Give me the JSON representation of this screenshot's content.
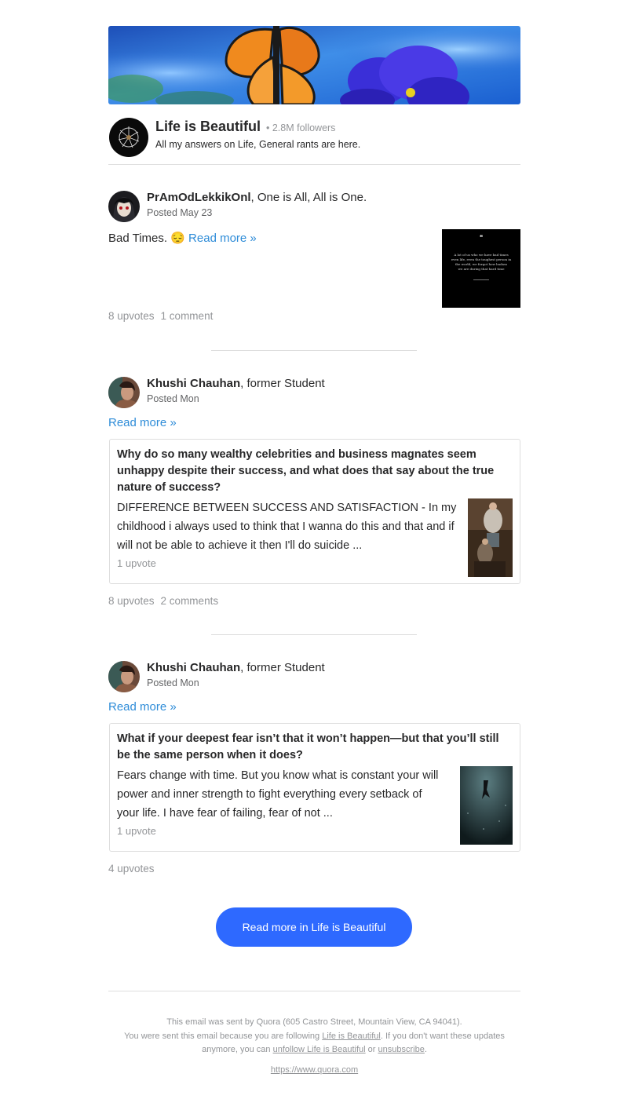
{
  "space": {
    "name": "Life is Beautiful",
    "followers": "• 2.8M followers",
    "description": "All my answers on Life, General rants are here."
  },
  "posts": [
    {
      "author_name": "PrAmOdLekkikOnl",
      "author_credential": ", One is All, All is One.",
      "posted": "Posted May 23",
      "text": "Bad Times. 😔",
      "read_more": "Read more »",
      "quote_lines": [
        "❝",
        "A lot of us who we have bad times",
        "even life, even the toughest person in",
        "the world, we forgot how badass",
        "we are during that hard time"
      ],
      "upvotes": "8 upvotes",
      "comments": "1 comment"
    },
    {
      "author_name": "Khushi Chauhan",
      "author_credential": ", former Student",
      "posted": "Posted Mon",
      "read_more": "Read more »",
      "card": {
        "question": "Why do so many wealthy celebrities and business magnates seem unhappy despite their success, and what does that say about the true nature of success?",
        "lines": [
          "DIFFERENCE BETWEEN SUCCESS AND SATISFACTION - In my",
          "childhood i always used to think that I wanna do this and that and if",
          "will not be able to achieve it then I'll do suicide ..."
        ],
        "upvote": "1 upvote"
      },
      "upvotes": "8 upvotes",
      "comments": "2 comments"
    },
    {
      "author_name": "Khushi Chauhan",
      "author_credential": ", former Student",
      "posted": "Posted Mon",
      "read_more": "Read more »",
      "card": {
        "question": "What if your deepest fear isn’t that it won’t happen—but that you’ll still be the same person when it does?",
        "lines": [
          "Fears change with time. But you know what is constant your will",
          "power and inner strength to fight everything every setback of",
          "your life. I have fear of failing, fear of not ..."
        ],
        "upvote": "1 upvote"
      },
      "upvotes": "4 upvotes"
    }
  ],
  "cta_label": "Read more in Life is Beautiful",
  "footer": {
    "line1": "This email was sent by Quora (605 Castro Street, Mountain View, CA 94041).",
    "line2_a": "You were sent this email because you are following ",
    "line2_link": "Life is Beautiful",
    "line2_b": ". If you don't want these updates",
    "line3_a": "anymore, you can ",
    "line3_link1": "unfollow Life is Beautiful",
    "line3_or": " or ",
    "line3_link2": "unsubscribe",
    "line3_end": ".",
    "url": "https://www.quora.com"
  }
}
